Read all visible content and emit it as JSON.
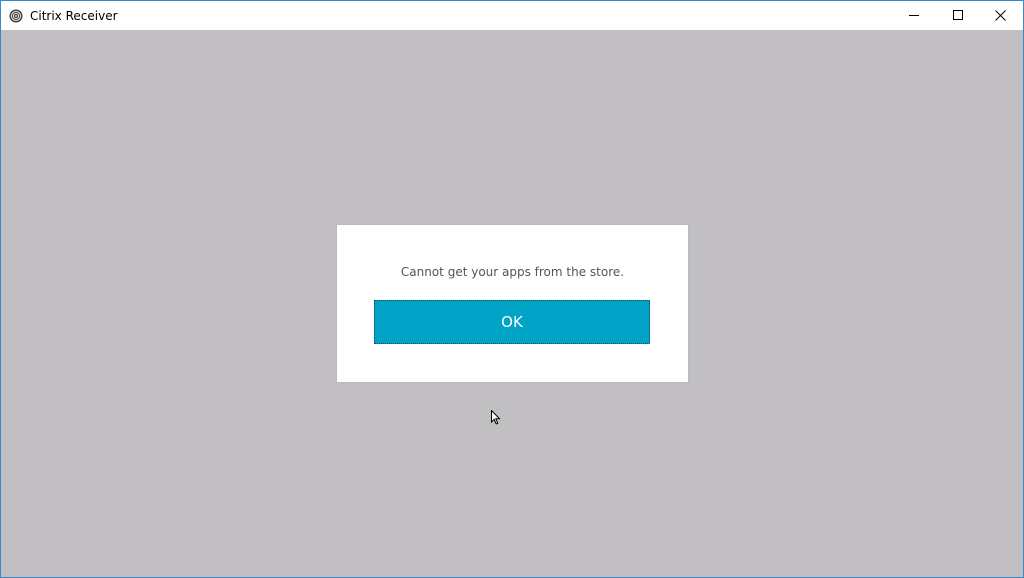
{
  "window": {
    "title": "Citrix Receiver",
    "icon": "citrix-receiver-icon",
    "controls": {
      "minimize_icon": "minimize-icon",
      "maximize_icon": "maximize-icon",
      "close_icon": "close-icon"
    }
  },
  "dialog": {
    "message": "Cannot get your apps from the store.",
    "ok_label": "OK"
  },
  "colors": {
    "background": "#c1bfc2",
    "accent_button": "#00a2c6",
    "window_border": "#3b88c9"
  }
}
